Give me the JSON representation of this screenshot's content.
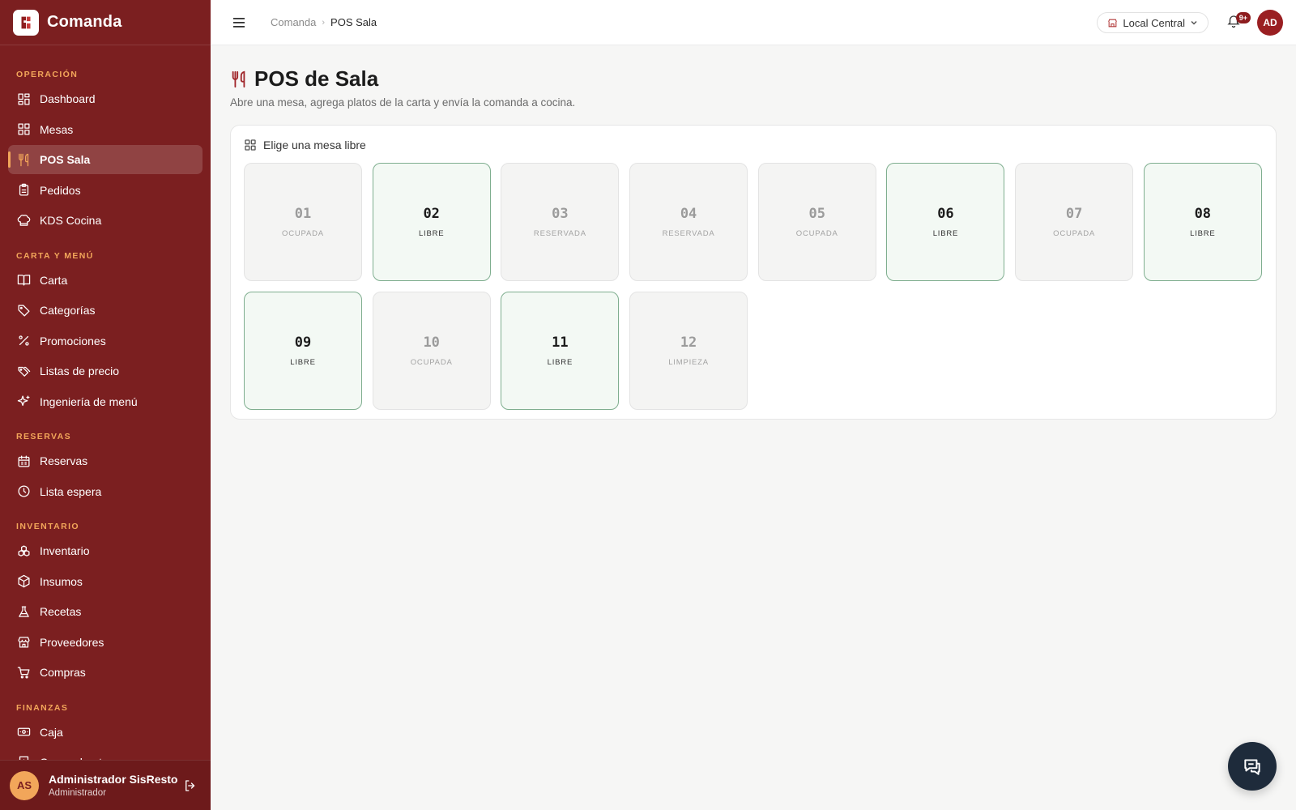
{
  "app": {
    "name": "Comanda"
  },
  "sidebar": {
    "sections": [
      {
        "title": "OPERACIÓN",
        "items": [
          {
            "label": "Dashboard",
            "icon": "dashboard-icon"
          },
          {
            "label": "Mesas",
            "icon": "grid-icon"
          },
          {
            "label": "POS Sala",
            "icon": "utensils-icon",
            "active": true
          },
          {
            "label": "Pedidos",
            "icon": "clipboard-icon"
          },
          {
            "label": "KDS Cocina",
            "icon": "chef-hat-icon"
          }
        ]
      },
      {
        "title": "CARTA Y MENÚ",
        "items": [
          {
            "label": "Carta",
            "icon": "book-icon"
          },
          {
            "label": "Categorías",
            "icon": "tag-icon"
          },
          {
            "label": "Promociones",
            "icon": "percent-icon"
          },
          {
            "label": "Listas de precio",
            "icon": "tags-icon"
          },
          {
            "label": "Ingeniería de menú",
            "icon": "sparkles-icon"
          }
        ]
      },
      {
        "title": "RESERVAS",
        "items": [
          {
            "label": "Reservas",
            "icon": "calendar-icon"
          },
          {
            "label": "Lista espera",
            "icon": "clock-icon"
          }
        ]
      },
      {
        "title": "INVENTARIO",
        "items": [
          {
            "label": "Inventario",
            "icon": "boxes-icon"
          },
          {
            "label": "Insumos",
            "icon": "package-icon"
          },
          {
            "label": "Recetas",
            "icon": "flask-icon"
          },
          {
            "label": "Proveedores",
            "icon": "store-icon"
          },
          {
            "label": "Compras",
            "icon": "cart-icon"
          }
        ]
      },
      {
        "title": "FINANZAS",
        "items": [
          {
            "label": "Caja",
            "icon": "cash-icon"
          },
          {
            "label": "Comprobantes",
            "icon": "receipt-icon"
          }
        ]
      }
    ],
    "user": {
      "initials": "AS",
      "name": "Administrador SisResto",
      "role": "Administrador"
    }
  },
  "topbar": {
    "breadcrumb": {
      "root": "Comanda",
      "current": "POS Sala"
    },
    "location": "Local Central",
    "notifications_badge": "9+",
    "avatar_initials": "AD"
  },
  "page": {
    "title": "POS de Sala",
    "subtitle": "Abre una mesa, agrega platos de la carta y envía la comanda a cocina.",
    "card_title": "Elige una mesa libre",
    "tables": [
      {
        "number": "01",
        "status": "OCUPADA"
      },
      {
        "number": "02",
        "status": "LIBRE"
      },
      {
        "number": "03",
        "status": "RESERVADA"
      },
      {
        "number": "04",
        "status": "RESERVADA"
      },
      {
        "number": "05",
        "status": "OCUPADA"
      },
      {
        "number": "06",
        "status": "LIBRE"
      },
      {
        "number": "07",
        "status": "OCUPADA"
      },
      {
        "number": "08",
        "status": "LIBRE"
      },
      {
        "number": "09",
        "status": "LIBRE"
      },
      {
        "number": "10",
        "status": "OCUPADA"
      },
      {
        "number": "11",
        "status": "LIBRE"
      },
      {
        "number": "12",
        "status": "LIMPIEZA"
      }
    ]
  },
  "colors": {
    "sidebar": "#7b1f20",
    "accent": "#f2a65a",
    "free_border": "#7fae8f",
    "fab": "#1e2b3b"
  }
}
